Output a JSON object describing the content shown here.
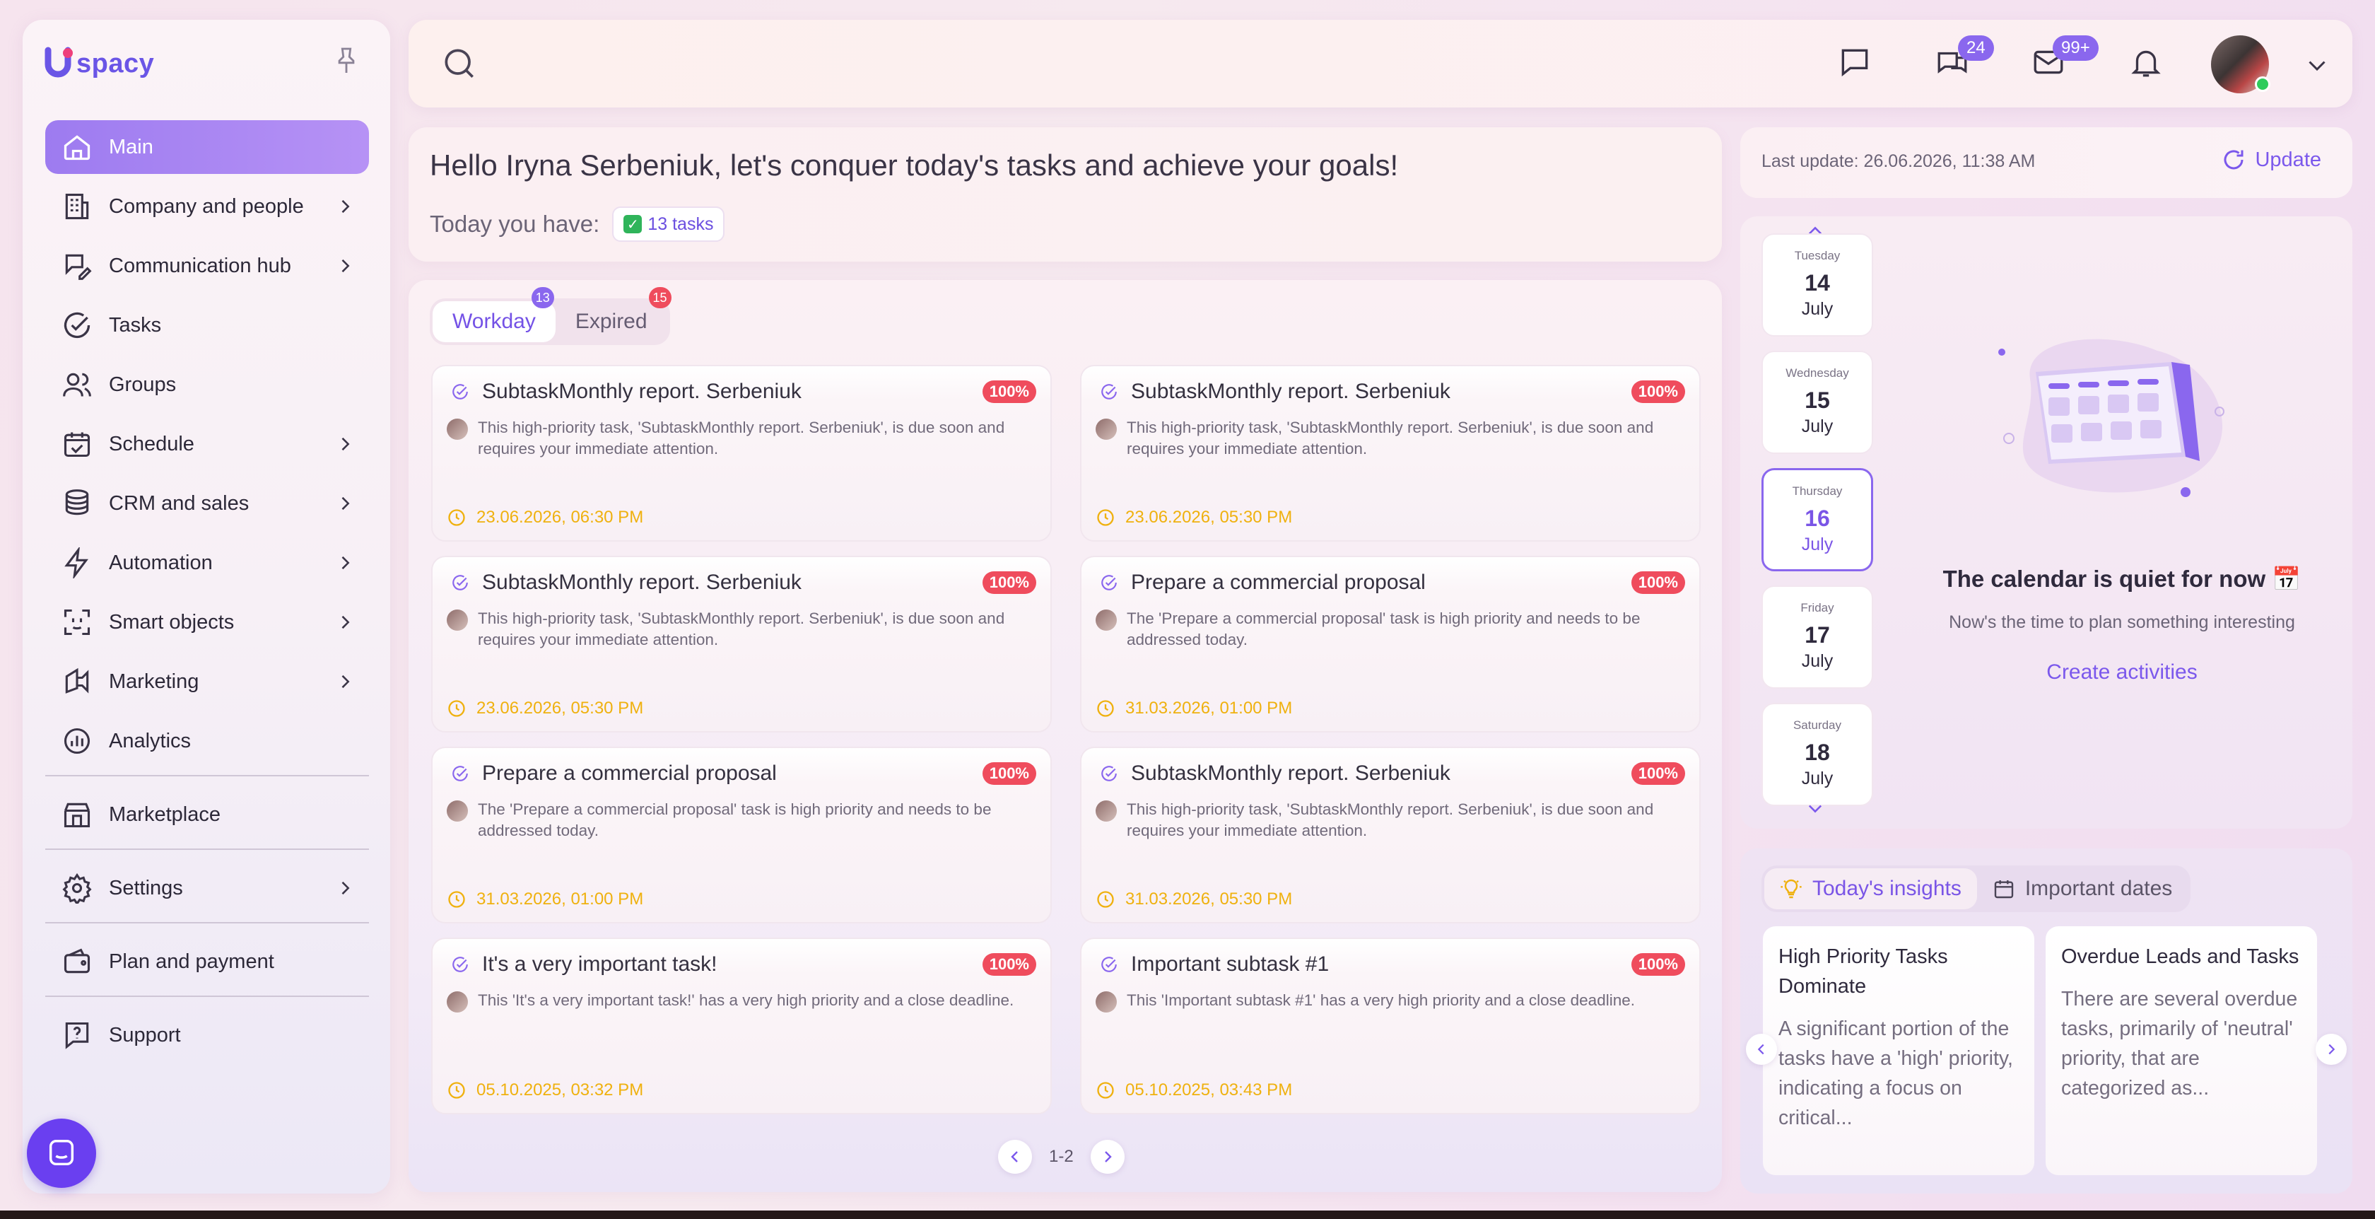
{
  "brand": {
    "name": "spacy"
  },
  "sidebar": {
    "items": [
      {
        "label": "Main"
      },
      {
        "label": "Company and people"
      },
      {
        "label": "Communication hub"
      },
      {
        "label": "Tasks"
      },
      {
        "label": "Groups"
      },
      {
        "label": "Schedule"
      },
      {
        "label": "CRM and sales"
      },
      {
        "label": "Automation"
      },
      {
        "label": "Smart objects"
      },
      {
        "label": "Marketing"
      },
      {
        "label": "Analytics"
      },
      {
        "label": "Marketplace"
      },
      {
        "label": "Settings"
      },
      {
        "label": "Plan and payment"
      },
      {
        "label": "Support"
      }
    ]
  },
  "topbar": {
    "chats_badge": "24",
    "mail_badge": "99+"
  },
  "greeting": {
    "title": "Hello Iryna Serbeniuk, let's conquer today's tasks and achieve your goals!",
    "today_label": "Today you have:",
    "tasks_chip": "13 tasks"
  },
  "tabs": [
    {
      "label": "Workday",
      "badge": "13"
    },
    {
      "label": "Expired",
      "badge": "15"
    }
  ],
  "cards": [
    {
      "title": "SubtaskMonthly report. Serbeniuk",
      "percent": "100%",
      "desc": "This high-priority task, 'SubtaskMonthly report. Serbeniuk', is due soon and requires your immediate attention.",
      "date": "23.06.2026, 06:30 PM"
    },
    {
      "title": "SubtaskMonthly report. Serbeniuk",
      "percent": "100%",
      "desc": "This high-priority task, 'SubtaskMonthly report. Serbeniuk', is due soon and requires your immediate attention.",
      "date": "23.06.2026, 05:30 PM"
    },
    {
      "title": "SubtaskMonthly report. Serbeniuk",
      "percent": "100%",
      "desc": "This high-priority task, 'SubtaskMonthly report. Serbeniuk', is due soon and requires your immediate attention.",
      "date": "23.06.2026, 05:30 PM"
    },
    {
      "title": "Prepare a commercial proposal",
      "percent": "100%",
      "desc": "The 'Prepare a commercial proposal' task is high priority and needs to be addressed today.",
      "date": "31.03.2026, 01:00 PM"
    },
    {
      "title": "Prepare a commercial proposal",
      "percent": "100%",
      "desc": "The 'Prepare a commercial proposal' task is high priority and needs to be addressed today.",
      "date": "31.03.2026, 01:00 PM"
    },
    {
      "title": "SubtaskMonthly report. Serbeniuk",
      "percent": "100%",
      "desc": "This high-priority task, 'SubtaskMonthly report. Serbeniuk', is due soon and requires your immediate attention.",
      "date": "31.03.2026, 05:30 PM"
    },
    {
      "title": "It's a very important task!",
      "percent": "100%",
      "desc": "This 'It's a very important task!' has a very high priority and a close deadline.",
      "date": "05.10.2025, 03:32 PM"
    },
    {
      "title": "Important subtask #1",
      "percent": "100%",
      "desc": "This 'Important subtask #1' has a very high priority and a close deadline.",
      "date": "05.10.2025, 03:43 PM"
    }
  ],
  "pager": {
    "label": "1-2"
  },
  "update": {
    "text": "Last update: 26.06.2026, 11:38 AM",
    "button": "Update"
  },
  "calendar": {
    "days": [
      {
        "weekday": "Tuesday",
        "day": "14",
        "month": "July"
      },
      {
        "weekday": "Wednesday",
        "day": "15",
        "month": "July"
      },
      {
        "weekday": "Thursday",
        "day": "16",
        "month": "July",
        "selected": true
      },
      {
        "weekday": "Friday",
        "day": "17",
        "month": "July"
      },
      {
        "weekday": "Saturday",
        "day": "18",
        "month": "July"
      }
    ],
    "empty_title": "The calendar is quiet for now 📅",
    "empty_sub": "Now's the time to plan something interesting",
    "create": "Create activities"
  },
  "insights": {
    "tabs": [
      {
        "label": "Today's insights"
      },
      {
        "label": "Important dates"
      }
    ],
    "cards": [
      {
        "title": "High Priority Tasks Dominate",
        "body": "A significant portion of the tasks have a 'high' priority, indicating a focus on critical..."
      },
      {
        "title": "Overdue Leads and Tasks",
        "body": "There are several overdue tasks, primarily of 'neutral' priority, that are categorized as..."
      }
    ]
  },
  "colors": {
    "accent": "#8a67ee",
    "danger": "#ef4c5d",
    "warning": "#efb10f",
    "success": "#2ecc5c"
  }
}
